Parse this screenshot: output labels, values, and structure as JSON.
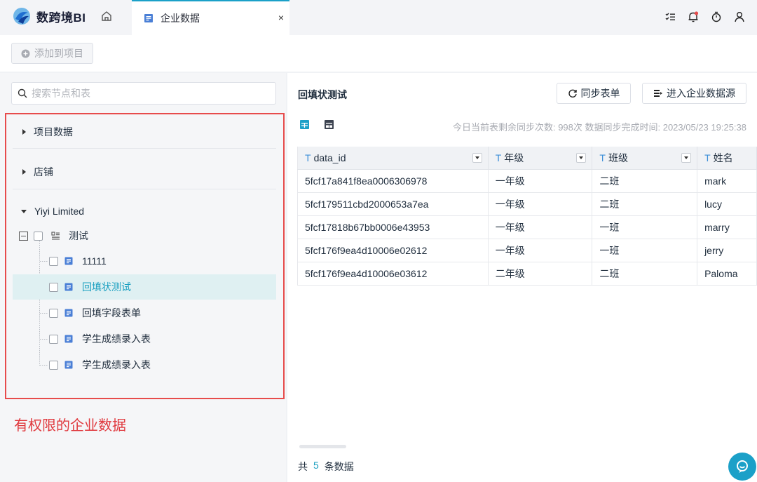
{
  "app": {
    "name": "数跨境BI",
    "brand_color": "#1ba0c8",
    "alert_color": "#e74c4c"
  },
  "tabs": [
    {
      "label": "企业数据",
      "close": "×"
    }
  ],
  "toolbar": {
    "add_to_project": "添加到项目"
  },
  "search": {
    "placeholder": "搜索节点和表"
  },
  "tree": {
    "groups": [
      {
        "label": "项目数据"
      },
      {
        "label": "店铺"
      },
      {
        "label": "Yiyi Limited"
      }
    ],
    "folder": {
      "label": "测试"
    },
    "items": [
      {
        "label": "11111"
      },
      {
        "label": "回填状测试"
      },
      {
        "label": "回填字段表单"
      },
      {
        "label": "学生成绩录入表"
      },
      {
        "label": "学生成绩录入表"
      }
    ]
  },
  "caption": "有权限的企业数据",
  "main": {
    "title": "回填状测试",
    "sync_button": "同步表单",
    "enter_button": "进入企业数据源",
    "sync_info": "今日当前表剩余同步次数: 998次   数据同步完成时间: 2023/05/23 19:25:38",
    "table": {
      "type_marker": "T",
      "columns": [
        "data_id",
        "年级",
        "班级",
        "姓名"
      ],
      "rows": [
        [
          "5fcf17a841f8ea0006306978",
          "一年级",
          "二班",
          "mark"
        ],
        [
          "5fcf179511cbd2000653a7ea",
          "一年级",
          "二班",
          "lucy"
        ],
        [
          "5fcf17818b67bb0006e43953",
          "一年级",
          "一班",
          "marry"
        ],
        [
          "5fcf176f9ea4d10006e02612",
          "一年级",
          "一班",
          "jerry"
        ],
        [
          "5fcf176f9ea4d10006e03612",
          "二年级",
          "二班",
          "Paloma"
        ]
      ]
    },
    "footer": {
      "prefix": "共",
      "count": "5",
      "suffix": "条数据"
    }
  }
}
